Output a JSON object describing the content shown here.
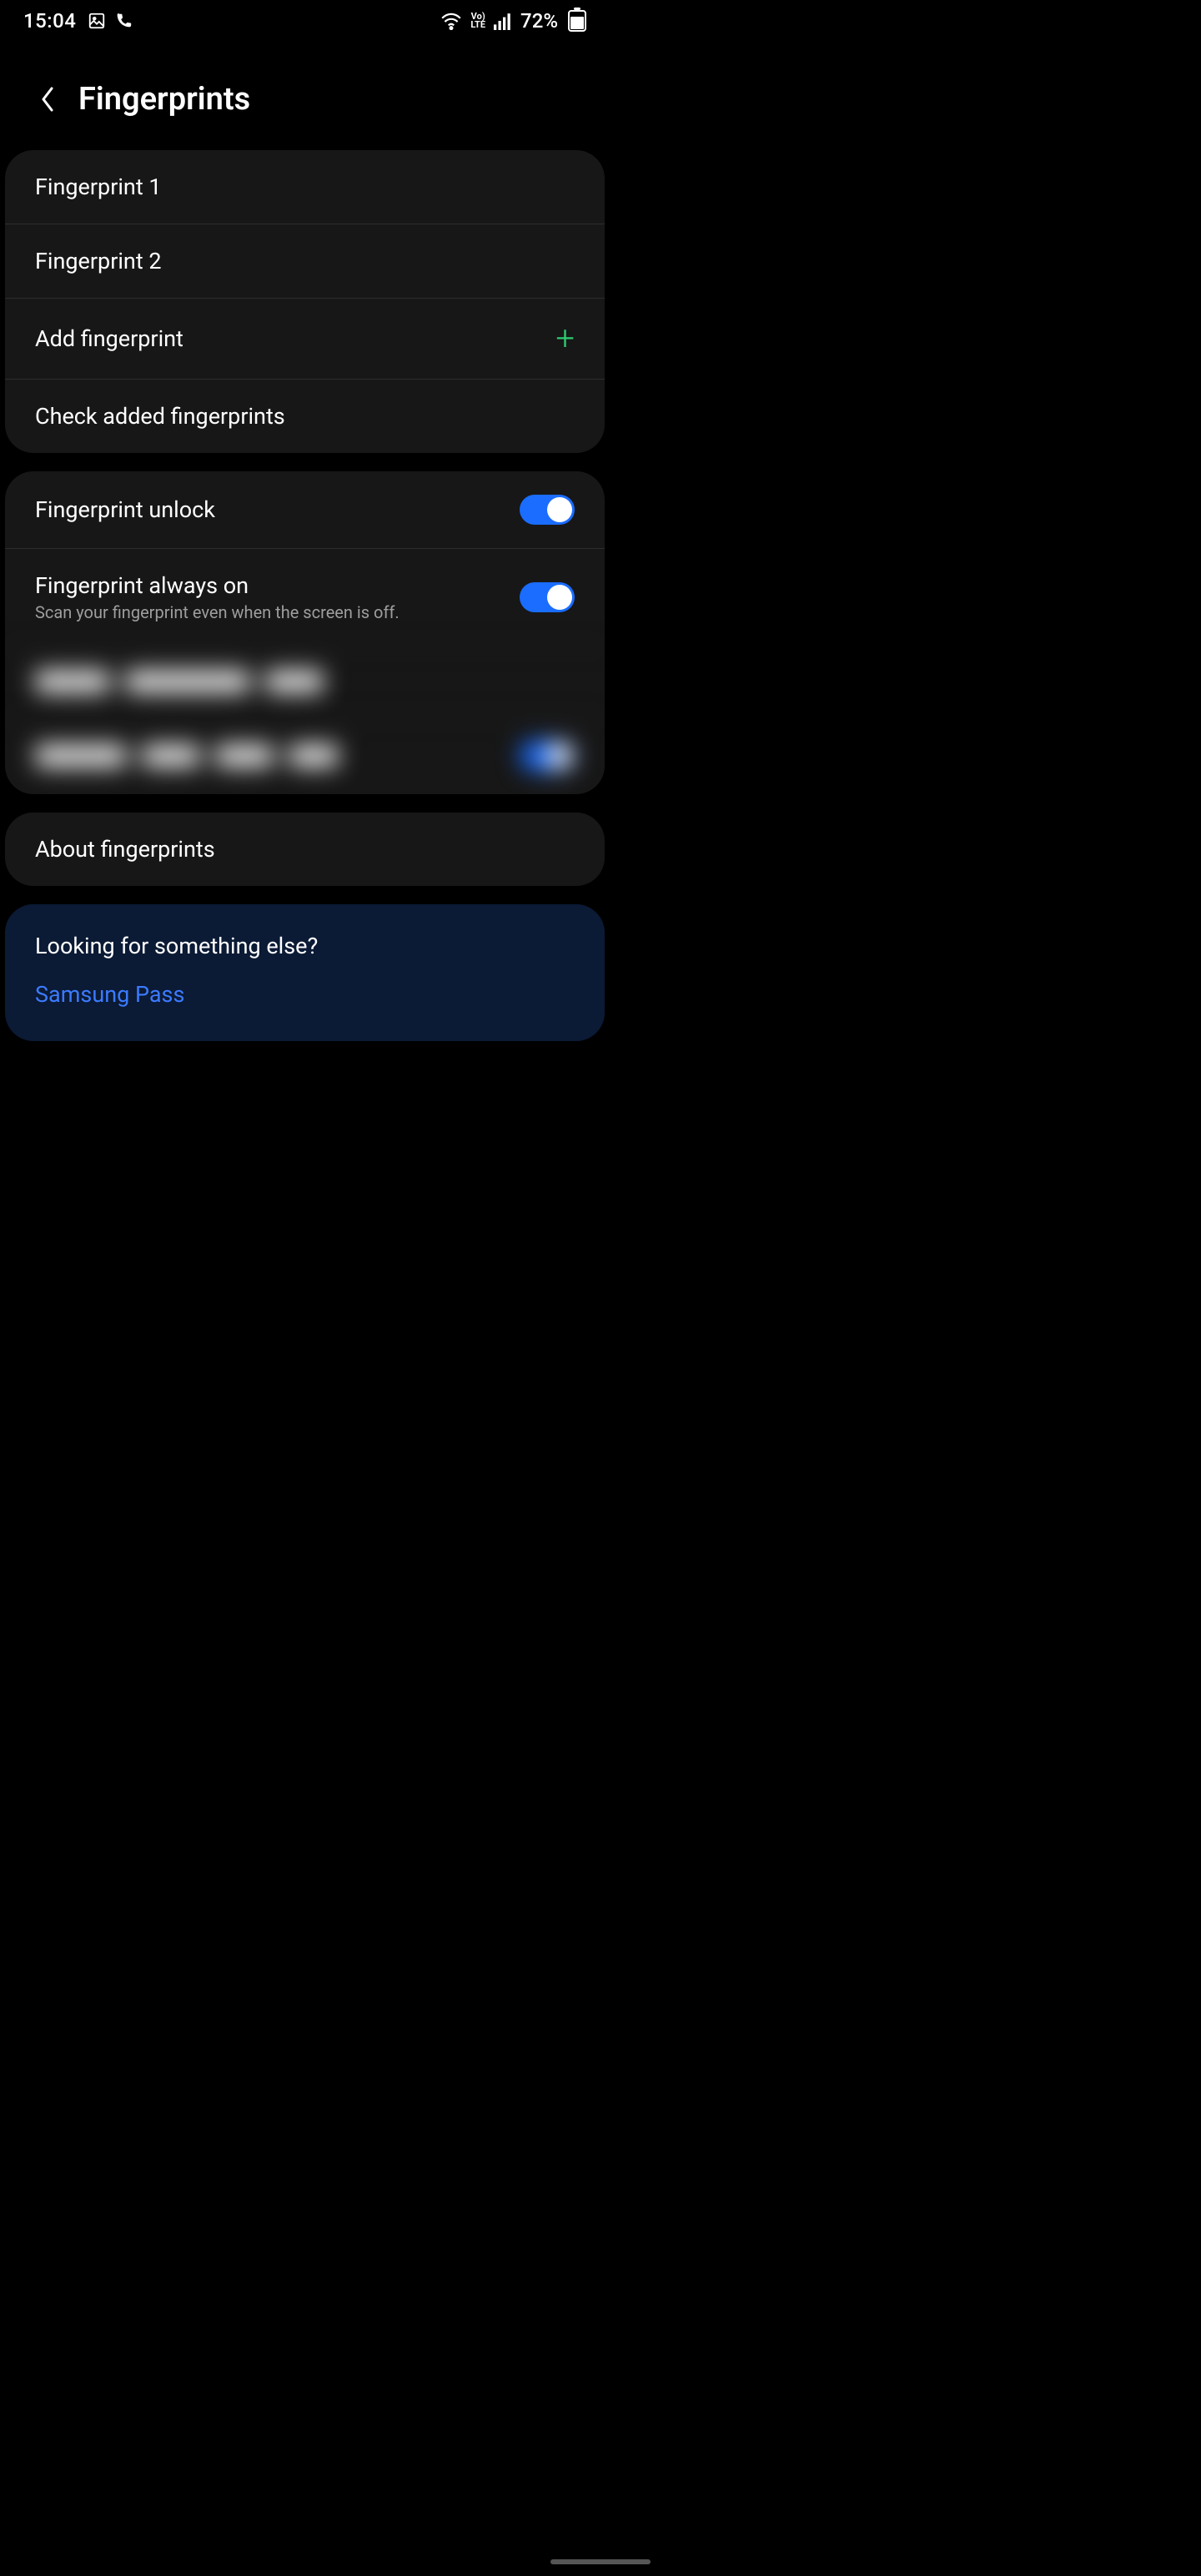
{
  "status": {
    "time": "15:04",
    "battery_pct": "72%"
  },
  "header": {
    "title": "Fingerprints"
  },
  "fingerprints": {
    "fp1": "Fingerprint 1",
    "fp2": "Fingerprint 2",
    "add": "Add fingerprint",
    "check": "Check added fingerprints"
  },
  "toggles": {
    "unlock": "Fingerprint unlock",
    "always_on": "Fingerprint always on",
    "always_on_sub": "Scan your fingerprint even when the screen is off."
  },
  "about": "About fingerprints",
  "more": {
    "lead": "Looking for something else?",
    "link": "Samsung Pass"
  }
}
